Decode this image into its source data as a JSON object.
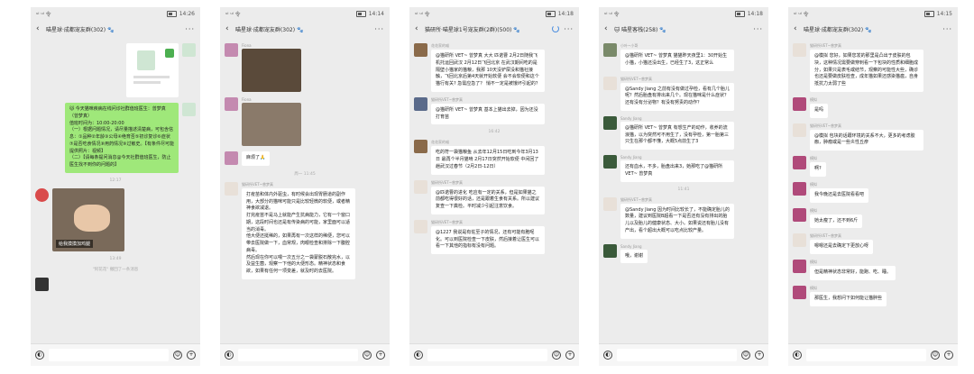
{
  "colors": {
    "green_bubble": "#9fe87a",
    "bg": "#ececec"
  },
  "phones": [
    {
      "status_left": "ᵘˡ ᵘˡ 令",
      "status_time": "14:26",
      "title": "喵星球·成都宠友群(302) 🐾",
      "msgs": {
        "m1": "🐱 今天猫咪疾病在线问诊社群值班医生：曾梦真（曾梦真）\n值班时间为：10:00-20:00\n（一）根据问题情况，请尽量描述清楚病，可包含信息：①品种②年龄③公母④绝育否⑤初诊复诊⑥症状⑦是否吃食情况⑧用药情况⑨过敏史。【有条件尽可能提供照片：视频】\n（二）【请每条提问消息@今天社群值班医生，防止医生找不到你的问题的】",
        "time1": "12:17",
        "img_caption": "给我摸摸加鸡腿",
        "time2": "13:49",
        "sys": "\"阿花花\" 撤回了一条消息"
      }
    },
    {
      "status_left": "ᵘˡ ᵘˡ 令",
      "status_time": "14:14",
      "title": "喵星球·成都宠友群(302) 🐾",
      "msgs": {
        "sender1": "Fiona",
        "sender2": "Fiona",
        "text3": "麻烦了🙏",
        "time1": "周一 11:45",
        "sender4": "猫研所VET~曾梦真",
        "text4": "打疫苗和体内外驱虫，有时候会出现胃肠道的副作用，大部分的猫咪可能只是比较轻微的软便，或者精神食欲减退。\n打完疫苗不是马上就能产生抗病能力，它有一个窗口期，这段时间也还是有传染病的可能，家里面可以适当的消毒。\n他大便还挺稀的，如果再有一次这样的稀便，您可以带去医院做一下，血常规，肉眼检查和排除一下腹腔病毒。\n然后现在你可以喂一次五分之一袋蒙脱石散完水，以及益生菌，观察一下他的大便形态。精神状态和食欲，如果有任何一项变差，就及时的去医院。"
      }
    },
    {
      "status_left": "ᵘˡ ᵘˡ 令",
      "status_time": "14:18",
      "title": "猫研所·喵星球1号宠友群(2群)(500) 🐾",
      "msgs": {
        "sender1": "花花家的喵",
        "text1": "@猫研所 VET~ 曾梦真 大大 匹诺曹 2月2日随我飞机托运回武汉 2月12日飞回北京 在武汉期间吃的是隔壁小猫家的猫粮，我那 10天没铲屎没和猫社接触，飞回北京后第4天就开始软便 会不会软便和这个猫行有关? 急需应急了？ 悄不一定是被饿坏引起的？",
        "sender2": "猫研所VET~曾梦真",
        "text2": "@猫研所 VET~ 曾梦真 基本上猫出去掉，因为还没打育苗",
        "time1": "16:42",
        "sender3": "花花家的喵",
        "text3": "吃的符一袋猫粮鱼 从去年12月15日吃到今年3月13日 最再个半月猫啃 2月17日突然开始软便 中间回了趟武汉过春节（2月2日-12日）",
        "sender4": "猫研所VET~曾梦真",
        "text4": "@匹诺曹的进化 吃应有一定的关系，但是如果猫之前都吃得很好的话，还是跟着生食有关系。所以建议复查一下粪检。平时减少引起注意饮食。",
        "sender5": "猫研所VET~曾梦真",
        "text5": "@1227 我说是有佐至子的情况，还有可能有胞呢化。可以到医院检查一下皮肤，然后接着让医生可以看一下其他的指标有没有问题。"
      }
    },
    {
      "status_left": "ᵘˡ ᵘˡ 令",
      "status_time": "14:18",
      "title": "🐱 喵星客栈(258) 🐾",
      "msgs": {
        "sender1": "小叶~小哥",
        "text1": "@猫研所 VET~ 曾梦真 猫猫昨天夜里1：30开始生小猫，小猫还没出生，已经生了3，这正常么",
        "sender2": "猫研所VET~曾梦真",
        "text2": "@Sandy Jiang 之前有没有做过孕检，看有几个胎儿呢？然后胎盘有排出来几个。现在猫咪是什么症状？还有没有分泌物？有没有努责的动作？",
        "sender3": "Sandy Jiang",
        "text3": "@猫研所 VET~ 曾梦真 有想生产的动作，收养的流浪猫，以为突然可不用生了，没有孕检，第一胎第三只生在那个都不懂，大概5点前生了3",
        "sender4": "Sandy Jiang",
        "text4": "还有血水，不多，胎盘出来3，她那吃了@猫研所 VET~ 曾梦真",
        "time1": "11:41",
        "sender5": "猫研所VET~曾梦真",
        "text5": "@Sandy Jiang 因为时间比较长了，不能确定胎儿的数量，建议到医院B超看一下是否还有没有排出的胎儿以及胎儿的健康状态、大小。如果说还有胎儿没有产出，看个超出大概可以吃点比较产量。",
        "sender6": "Sandy Jiang",
        "text6": "哦，谢谢"
      }
    },
    {
      "status_left": "ᵘˡ ᵘˡ 令",
      "status_time": "14:15",
      "title": "喵星球·成都宠友群(302) 🐾",
      "msgs": {
        "sender1": "猫研所VET~曾梦真",
        "text1": "@模拟 您好，如果您发的那里是凸出于皮肤的包块，这种情况需要做穿刺看一下包块的性质和细胞成分，如果只是表毛或结节，观察的可能性大些，确诊也还是要做皮肤检查，成年猫如果还感染猫瘟，自身抵抗力太弱了些",
        "sender2": "模拟",
        "text2": "是吗",
        "sender3": "猫研所VET~曾梦真",
        "text3": "@模拟 包块的话跟环境的关系不大，更多的考虑胶痂，肿瘤或是一些炎性丘疹",
        "sender4": "模拟",
        "text4": "啊?",
        "sender5": "模拟",
        "text5": "我今晚还是去医院看看吧",
        "sender6": "模拟",
        "text6": "她太瘦了，还不到6斤",
        "sender7": "猫研所VET~曾梦真",
        "text7": "嗯嗯还是去确定下更放心呀",
        "sender8": "模拟",
        "text8": "但是精神状态非常好，能跑、吃、睡。",
        "sender9": "模拟",
        "text9": "那医生，我想问下如何能让猫胖些"
      }
    }
  ]
}
